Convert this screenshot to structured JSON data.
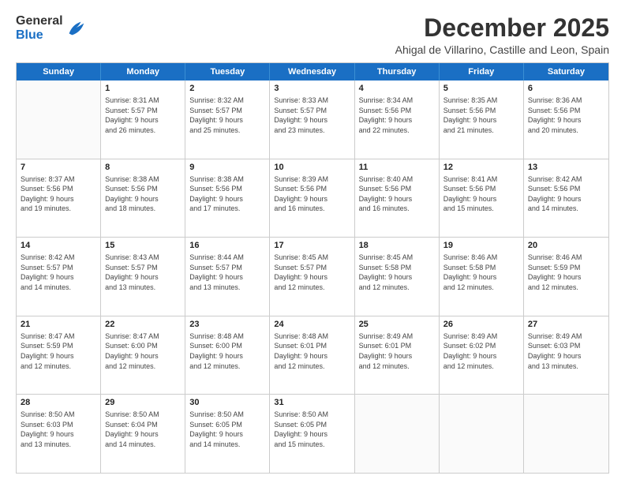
{
  "header": {
    "logo_line1": "General",
    "logo_line2": "Blue",
    "title": "December 2025",
    "subtitle": "Ahigal de Villarino, Castille and Leon, Spain"
  },
  "days": [
    "Sunday",
    "Monday",
    "Tuesday",
    "Wednesday",
    "Thursday",
    "Friday",
    "Saturday"
  ],
  "rows": [
    [
      {
        "date": "",
        "info": ""
      },
      {
        "date": "1",
        "info": "Sunrise: 8:31 AM\nSunset: 5:57 PM\nDaylight: 9 hours\nand 26 minutes."
      },
      {
        "date": "2",
        "info": "Sunrise: 8:32 AM\nSunset: 5:57 PM\nDaylight: 9 hours\nand 25 minutes."
      },
      {
        "date": "3",
        "info": "Sunrise: 8:33 AM\nSunset: 5:57 PM\nDaylight: 9 hours\nand 23 minutes."
      },
      {
        "date": "4",
        "info": "Sunrise: 8:34 AM\nSunset: 5:56 PM\nDaylight: 9 hours\nand 22 minutes."
      },
      {
        "date": "5",
        "info": "Sunrise: 8:35 AM\nSunset: 5:56 PM\nDaylight: 9 hours\nand 21 minutes."
      },
      {
        "date": "6",
        "info": "Sunrise: 8:36 AM\nSunset: 5:56 PM\nDaylight: 9 hours\nand 20 minutes."
      }
    ],
    [
      {
        "date": "7",
        "info": "Sunrise: 8:37 AM\nSunset: 5:56 PM\nDaylight: 9 hours\nand 19 minutes."
      },
      {
        "date": "8",
        "info": "Sunrise: 8:38 AM\nSunset: 5:56 PM\nDaylight: 9 hours\nand 18 minutes."
      },
      {
        "date": "9",
        "info": "Sunrise: 8:38 AM\nSunset: 5:56 PM\nDaylight: 9 hours\nand 17 minutes."
      },
      {
        "date": "10",
        "info": "Sunrise: 8:39 AM\nSunset: 5:56 PM\nDaylight: 9 hours\nand 16 minutes."
      },
      {
        "date": "11",
        "info": "Sunrise: 8:40 AM\nSunset: 5:56 PM\nDaylight: 9 hours\nand 16 minutes."
      },
      {
        "date": "12",
        "info": "Sunrise: 8:41 AM\nSunset: 5:56 PM\nDaylight: 9 hours\nand 15 minutes."
      },
      {
        "date": "13",
        "info": "Sunrise: 8:42 AM\nSunset: 5:56 PM\nDaylight: 9 hours\nand 14 minutes."
      }
    ],
    [
      {
        "date": "14",
        "info": "Sunrise: 8:42 AM\nSunset: 5:57 PM\nDaylight: 9 hours\nand 14 minutes."
      },
      {
        "date": "15",
        "info": "Sunrise: 8:43 AM\nSunset: 5:57 PM\nDaylight: 9 hours\nand 13 minutes."
      },
      {
        "date": "16",
        "info": "Sunrise: 8:44 AM\nSunset: 5:57 PM\nDaylight: 9 hours\nand 13 minutes."
      },
      {
        "date": "17",
        "info": "Sunrise: 8:45 AM\nSunset: 5:57 PM\nDaylight: 9 hours\nand 12 minutes."
      },
      {
        "date": "18",
        "info": "Sunrise: 8:45 AM\nSunset: 5:58 PM\nDaylight: 9 hours\nand 12 minutes."
      },
      {
        "date": "19",
        "info": "Sunrise: 8:46 AM\nSunset: 5:58 PM\nDaylight: 9 hours\nand 12 minutes."
      },
      {
        "date": "20",
        "info": "Sunrise: 8:46 AM\nSunset: 5:59 PM\nDaylight: 9 hours\nand 12 minutes."
      }
    ],
    [
      {
        "date": "21",
        "info": "Sunrise: 8:47 AM\nSunset: 5:59 PM\nDaylight: 9 hours\nand 12 minutes."
      },
      {
        "date": "22",
        "info": "Sunrise: 8:47 AM\nSunset: 6:00 PM\nDaylight: 9 hours\nand 12 minutes."
      },
      {
        "date": "23",
        "info": "Sunrise: 8:48 AM\nSunset: 6:00 PM\nDaylight: 9 hours\nand 12 minutes."
      },
      {
        "date": "24",
        "info": "Sunrise: 8:48 AM\nSunset: 6:01 PM\nDaylight: 9 hours\nand 12 minutes."
      },
      {
        "date": "25",
        "info": "Sunrise: 8:49 AM\nSunset: 6:01 PM\nDaylight: 9 hours\nand 12 minutes."
      },
      {
        "date": "26",
        "info": "Sunrise: 8:49 AM\nSunset: 6:02 PM\nDaylight: 9 hours\nand 12 minutes."
      },
      {
        "date": "27",
        "info": "Sunrise: 8:49 AM\nSunset: 6:03 PM\nDaylight: 9 hours\nand 13 minutes."
      }
    ],
    [
      {
        "date": "28",
        "info": "Sunrise: 8:50 AM\nSunset: 6:03 PM\nDaylight: 9 hours\nand 13 minutes."
      },
      {
        "date": "29",
        "info": "Sunrise: 8:50 AM\nSunset: 6:04 PM\nDaylight: 9 hours\nand 14 minutes."
      },
      {
        "date": "30",
        "info": "Sunrise: 8:50 AM\nSunset: 6:05 PM\nDaylight: 9 hours\nand 14 minutes."
      },
      {
        "date": "31",
        "info": "Sunrise: 8:50 AM\nSunset: 6:05 PM\nDaylight: 9 hours\nand 15 minutes."
      },
      {
        "date": "",
        "info": ""
      },
      {
        "date": "",
        "info": ""
      },
      {
        "date": "",
        "info": ""
      }
    ]
  ]
}
